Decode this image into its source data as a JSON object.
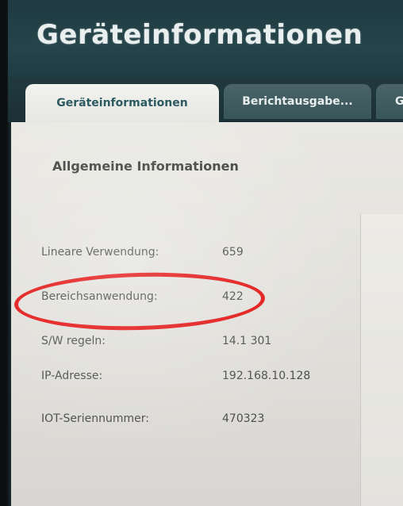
{
  "app": {
    "title": "Geräteinformationen"
  },
  "tabs": [
    {
      "label": "Geräteinformationen",
      "active": true
    },
    {
      "label": "Berichtausgabe...",
      "active": false
    },
    {
      "label": "G",
      "active": false
    }
  ],
  "section": {
    "title": "Allgemeine Informationen"
  },
  "info": [
    {
      "label": "Lineare Verwendung:",
      "value": "659"
    },
    {
      "label": "Bereichsanwendung:",
      "value": "422"
    },
    {
      "label": "S/W regeln:",
      "value": "14.1 301"
    },
    {
      "label": "IP-Adresse:",
      "value": "192.168.10.128"
    },
    {
      "label": "IOT-Seriennummer:",
      "value": "470323"
    }
  ],
  "colors": {
    "header": "#24454b",
    "active_tab_text": "#2b5a60",
    "highlight": "#e21010"
  }
}
